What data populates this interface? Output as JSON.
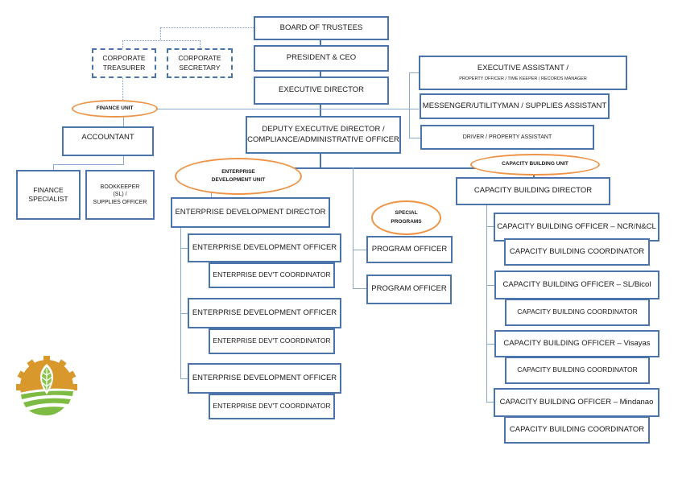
{
  "board": "BOARD OF TRUSTEES",
  "president": "PRESIDENT & CEO",
  "executive_director": "EXECUTIVE DIRECTOR",
  "deputy": [
    "DEPUTY EXECUTIVE DIRECTOR /",
    "COMPLIANCE/ADMINISTRATIVE OFFICER"
  ],
  "corporate_treasurer": [
    "CORPORATE",
    "TREASURER"
  ],
  "corporate_secretary": [
    "CORPORATE",
    "SECRETARY"
  ],
  "executive_assistant": {
    "title": "EXECUTIVE ASSISTANT /",
    "subtitle": "PROPERTY OFFICER / TIME KEEPER / RECORDS MANAGER"
  },
  "messenger": "MESSENGER/UTILITYMAN / SUPPLIES ASSISTANT",
  "driver": "DRIVER / PROPERTY ASSISTANT",
  "finance_unit": {
    "label": "FINANCE UNIT",
    "accountant": "ACCOUNTANT",
    "finance_specialist": [
      "FINANCE",
      "SPECIALIST"
    ],
    "bookkeeper": [
      "BOOKKEEPER",
      "(SL) /",
      "SUPPLIES OFFICER"
    ]
  },
  "enterprise_unit": {
    "label": [
      "ENTERPRISE",
      "DEVELOPMENT UNIT"
    ],
    "director": "ENTERPRISE DEVELOPMENT DIRECTOR",
    "officers": [
      {
        "officer": "ENTERPRISE DEVELOPMENT OFFICER",
        "coordinator": "ENTERPRISE DEV'T COORDINATOR"
      },
      {
        "officer": "ENTERPRISE DEVELOPMENT OFFICER",
        "coordinator": "ENTERPRISE DEV'T COORDINATOR"
      },
      {
        "officer": "ENTERPRISE DEVELOPMENT OFFICER",
        "coordinator": "ENTERPRISE DEV'T COORDINATOR"
      }
    ]
  },
  "special_programs": {
    "label": [
      "SPECIAL",
      "PROGRAMS"
    ],
    "officers": [
      "PROGRAM OFFICER",
      "PROGRAM OFFICER"
    ]
  },
  "capacity_unit": {
    "label": "CAPACITY BUILDING UNIT",
    "director": "CAPACITY BUILDING DIRECTOR",
    "officers": [
      {
        "officer": "CAPACITY BUILDING OFFICER – NCR/N&CL",
        "coordinator": "CAPACITY BUILDING COORDINATOR"
      },
      {
        "officer": "CAPACITY BUILDING OFFICER – SL/Bicol",
        "coordinator": "CAPACITY BUILDING COORDINATOR"
      },
      {
        "officer": "CAPACITY BUILDING OFFICER – Visayas",
        "coordinator": "CAPACITY BUILDING COORDINATOR"
      },
      {
        "officer": "CAPACITY BUILDING OFFICER – Mindanao",
        "coordinator": "CAPACITY BUILDING COORDINATOR"
      }
    ]
  },
  "colors": {
    "box_border": "#4a74aa",
    "unit_oval": "#ee9447",
    "logo_gold": "#d9982c",
    "logo_green": "#7dbb42"
  }
}
